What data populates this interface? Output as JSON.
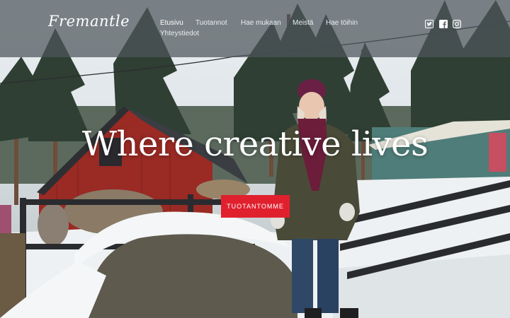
{
  "brand": {
    "logo_text": "Fremantle"
  },
  "nav": {
    "items": [
      {
        "label": "Etusivu",
        "active": true
      },
      {
        "label": "Tuotannot",
        "active": false
      },
      {
        "label": "Hae mukaan",
        "active": false
      },
      {
        "label": "Meistä",
        "active": false
      },
      {
        "label": "Hae töihin",
        "active": false
      },
      {
        "label": "Yhteystiedot",
        "active": false
      }
    ]
  },
  "social": [
    "twitter-icon",
    "facebook-icon",
    "instagram-icon"
  ],
  "hero": {
    "headline": "Where creative lives",
    "cta_label": "TUOTANTOMME"
  },
  "colors": {
    "accent": "#e1202e",
    "header_bg": "#4e565c"
  }
}
